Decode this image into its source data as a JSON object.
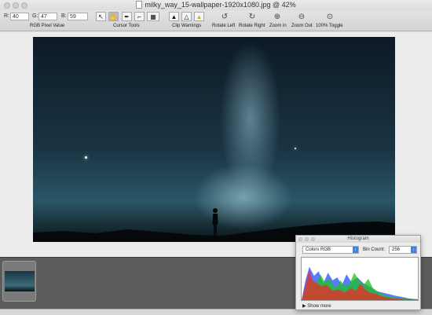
{
  "window": {
    "title": "milky_way_15-wallpaper-1920x1080.jpg @ 42%"
  },
  "toolbar": {
    "rgb": {
      "r_label": "R:",
      "r_value": "40",
      "g_label": "G:",
      "g_value": "47",
      "b_label": "B:",
      "b_value": "59",
      "group_label": "RGB Pixel Value"
    },
    "cursor_tools": {
      "group_label": "Cursor Tools",
      "selected": "hand-icon"
    },
    "clip_warnings": {
      "group_label": "Clip Warnings"
    },
    "rotate_left": "Rotate Left",
    "rotate_right": "Rotate Right",
    "zoom_in": "Zoom in",
    "zoom_out": "Zoom Out",
    "toggle_100": "100% Toggle"
  },
  "histogram": {
    "title": "Histogram",
    "colors_value": "Colors RGB",
    "bin_label": "Bin Count:",
    "bin_value": "256",
    "show_more": "Show more",
    "colors": {
      "red": "#ff2020",
      "green": "#20c020",
      "blue": "#2050ff"
    }
  }
}
